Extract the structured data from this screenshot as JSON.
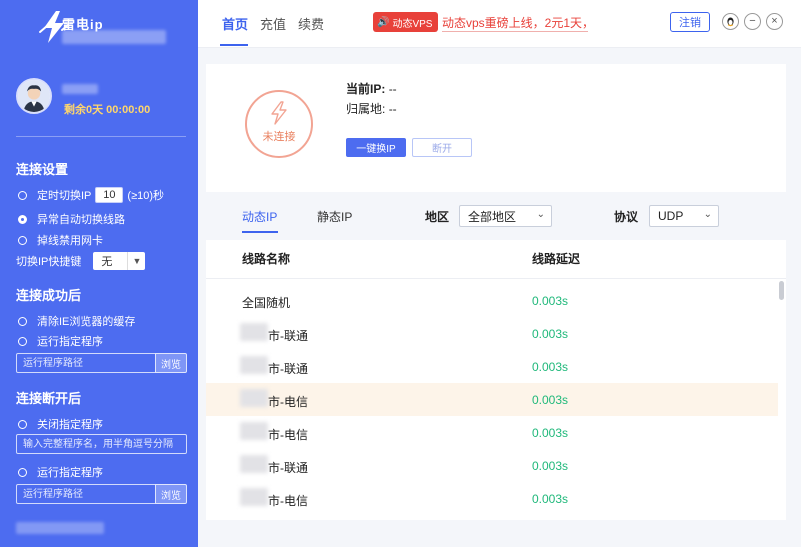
{
  "app": {
    "brand_name": "雷电ip",
    "remaining": "剩余0天 00:00:00"
  },
  "sidebar": {
    "connect_settings": {
      "title": "连接设置",
      "timed_switch_prefix": "定时切换IP",
      "timed_switch_value": "10",
      "timed_switch_suffix": "(≥10)秒",
      "auto_switch": "异常自动切换线路",
      "disable_nic": "掉线禁用网卡",
      "hotkey_label": "切换IP快捷键",
      "hotkey_value": "无"
    },
    "on_success": {
      "title": "连接成功后",
      "clear_cache": "清除IE浏览器的缓存",
      "run_program": "运行指定程序",
      "path_placeholder": "运行程序路径",
      "browse": "浏览"
    },
    "on_disconnect": {
      "title": "连接断开后",
      "close_program": "关闭指定程序",
      "close_placeholder": "输入完整程序名，用半角逗号分隔",
      "run_program": "运行指定程序",
      "path_placeholder": "运行程序路径",
      "browse": "浏览"
    }
  },
  "topbar": {
    "tabs": [
      {
        "label": "首页",
        "active": true
      },
      {
        "label": "充值",
        "active": false
      },
      {
        "label": "续费",
        "active": false
      }
    ],
    "badge": "动态VPS",
    "marquee": "动态vps重磅上线，2元1天，0",
    "logout": "注销",
    "window_buttons": [
      "qq-icon",
      "minimize-icon",
      "close-icon"
    ]
  },
  "status": {
    "state": "未连接",
    "current_ip_label": "当前IP:",
    "current_ip_value": "--",
    "location_label": "归属地:",
    "location_value": "--",
    "switch_button": "一键换IP",
    "disconnect_button": "断开"
  },
  "filters": {
    "tabs": [
      {
        "label": "动态IP",
        "active": true
      },
      {
        "label": "静态IP",
        "active": false
      }
    ],
    "region_label": "地区",
    "region_value": "全部地区",
    "protocol_label": "协议",
    "protocol_value": "UDP"
  },
  "table": {
    "headers": [
      "线路名称",
      "线路延迟"
    ],
    "rows": [
      {
        "name": "全国随机",
        "name_suffix": "",
        "delay": "0.003s",
        "selected": false
      },
      {
        "name": "",
        "name_suffix": "市-联通",
        "delay": "0.003s",
        "selected": false
      },
      {
        "name": "",
        "name_suffix": "市-联通",
        "delay": "0.003s",
        "selected": false
      },
      {
        "name": "",
        "name_suffix": "市-电信",
        "delay": "0.003s",
        "selected": true
      },
      {
        "name": "",
        "name_suffix": "市-电信",
        "delay": "0.003s",
        "selected": false
      },
      {
        "name": "",
        "name_suffix": "市-联通",
        "delay": "0.003s",
        "selected": false
      },
      {
        "name": "",
        "name_suffix": "市-电信",
        "delay": "0.003s",
        "selected": false
      }
    ]
  },
  "colors": {
    "sidebar": "#4d6cf0",
    "accent": "#3d63ee",
    "danger": "#e8413a",
    "delay": "#1fb87a",
    "status_ring": "#f2a493",
    "remaining": "#ffd66b"
  }
}
